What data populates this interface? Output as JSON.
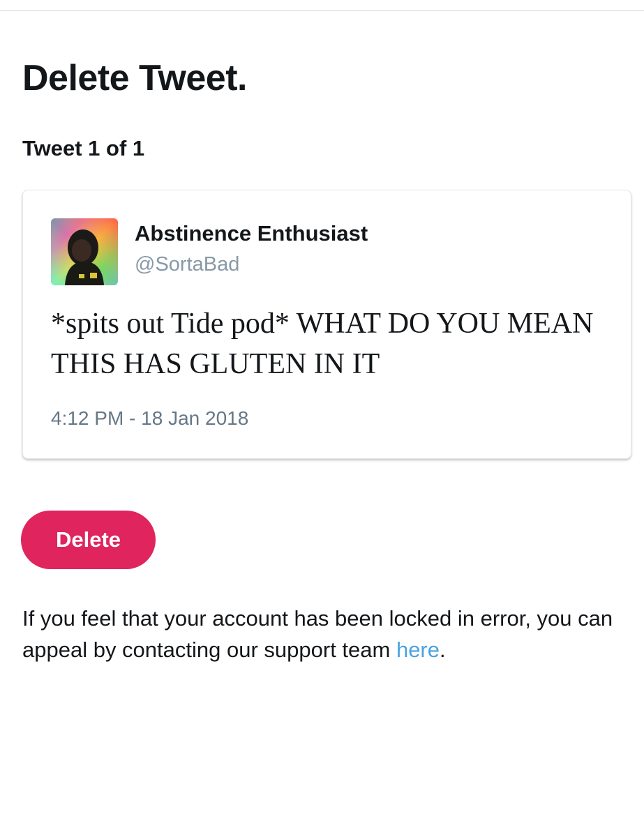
{
  "page": {
    "title": "Delete Tweet.",
    "tweet_count": "Tweet 1 of 1"
  },
  "tweet": {
    "display_name": "Abstinence Enthusiast",
    "handle": "@SortaBad",
    "text": "*spits out Tide pod* WHAT DO YOU MEAN THIS HAS GLUTEN IN IT",
    "timestamp": "4:12 PM - 18 Jan 2018",
    "avatar_icon": "profile-avatar-image"
  },
  "actions": {
    "delete_label": "Delete"
  },
  "appeal": {
    "text_before": "If you feel that your account has been locked in error, you can appeal by contacting our support team ",
    "link_label": "here",
    "text_after": "."
  },
  "colors": {
    "delete_button": "#e0245e",
    "link": "#4aa2e0",
    "handle": "#8899a6",
    "timestamp": "#657786",
    "text": "#14171a"
  }
}
